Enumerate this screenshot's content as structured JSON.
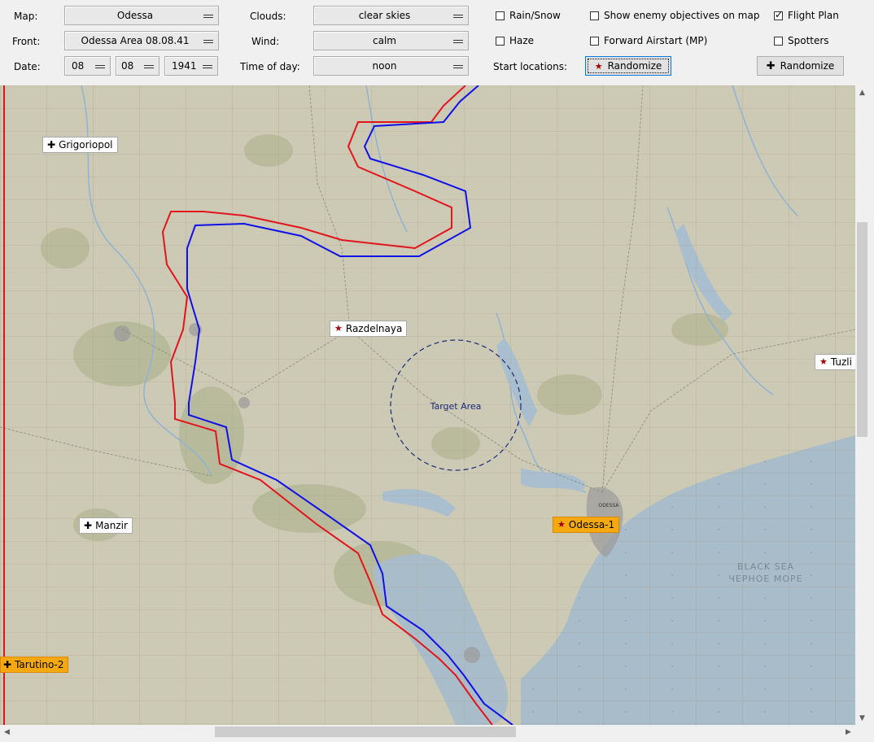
{
  "labels": {
    "map": "Map:",
    "front": "Front:",
    "date": "Date:",
    "clouds": "Clouds:",
    "wind": "Wind:",
    "time_of_day": "Time of day:",
    "start_locations": "Start locations:"
  },
  "selects": {
    "map": "Odessa",
    "front": "Odessa Area 08.08.41",
    "day": "08",
    "month": "08",
    "year": "1941",
    "clouds": "clear skies",
    "wind": "calm",
    "time_of_day": "noon"
  },
  "checkboxes": {
    "rain_snow": {
      "label": "Rain/Snow",
      "checked": false
    },
    "haze": {
      "label": "Haze",
      "checked": false
    },
    "show_enemy": {
      "label": "Show enemy objectives on map",
      "checked": false
    },
    "forward_airstart": {
      "label": "Forward Airstart (MP)",
      "checked": false
    },
    "flight_plan": {
      "label": "Flight Plan",
      "checked": true
    },
    "spotters": {
      "label": "Spotters",
      "checked": false
    }
  },
  "buttons": {
    "randomize_start": "Randomize",
    "randomize_airfield": "Randomize"
  },
  "map": {
    "target_label": "Target Area",
    "sea_label_en": "BLACK SEA",
    "sea_label_ru": "ЧЕРНОЕ МОРЕ",
    "city_label": "ODESSA",
    "markers": [
      {
        "name": "Grigoriopol",
        "type": "airfield",
        "selected": false
      },
      {
        "name": "Razdelnaya",
        "type": "start",
        "selected": false
      },
      {
        "name": "Tuzli",
        "type": "start",
        "selected": false
      },
      {
        "name": "Manzir",
        "type": "airfield",
        "selected": false
      },
      {
        "name": "Odessa-1",
        "type": "start",
        "selected": true
      },
      {
        "name": "Tarutino-2",
        "type": "airfield",
        "selected": true
      }
    ]
  },
  "icons": {
    "airfield": "cross-icon",
    "start": "star-icon"
  },
  "colors": {
    "front_red": "#e4141c",
    "front_blue": "#1010e8",
    "target": "#1a2a7a",
    "selected_marker": "#f5a90f"
  }
}
